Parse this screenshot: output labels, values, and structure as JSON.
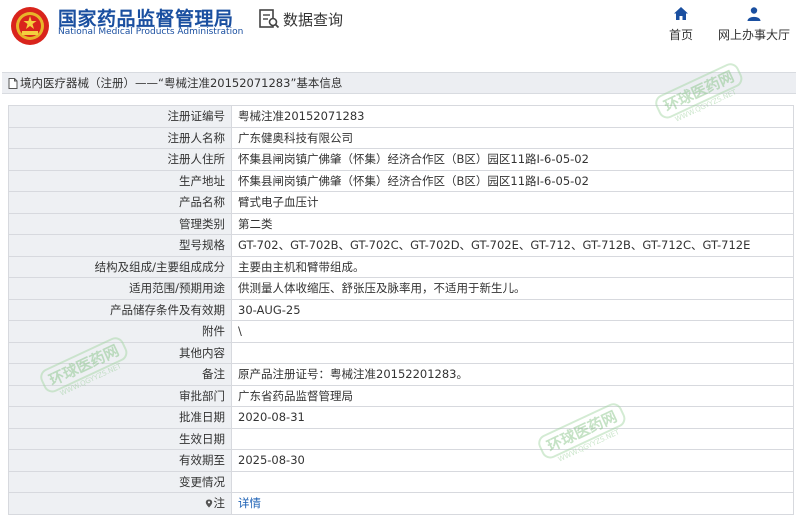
{
  "header": {
    "org_name_cn": "国家药品监督管理局",
    "org_name_en": "National Medical Products Administration",
    "query_label": "数据查询",
    "nav": {
      "home": "首页",
      "online_hall": "网上办事大厅"
    }
  },
  "breadcrumb": "境内医疗器械（注册）——“粤械注准20152071283”基本信息",
  "watermark": {
    "brand": "环球医药网",
    "site": "WWW.QGYYZS.NET"
  },
  "record": {
    "reg_no": {
      "label": "注册证编号",
      "value": "粤械注准20152071283"
    },
    "registrant": {
      "label": "注册人名称",
      "value": "广东健奥科技有限公司"
    },
    "residence": {
      "label": "注册人住所",
      "value": "怀集县闸岗镇广佛肇（怀集）经济合作区（B区）园区11路Ⅰ-6-05-02"
    },
    "mfg_address": {
      "label": "生产地址",
      "value": "怀集县闸岗镇广佛肇（怀集）经济合作区（B区）园区11路Ⅰ-6-05-02"
    },
    "product_name": {
      "label": "产品名称",
      "value": "臂式电子血压计"
    },
    "category": {
      "label": "管理类别",
      "value": "第二类"
    },
    "models": {
      "label": "型号规格",
      "value": "GT-702、GT-702B、GT-702C、GT-702D、GT-702E、GT-712、GT-712B、GT-712C、GT-712E"
    },
    "structure": {
      "label": "结构及组成/主要组成成分",
      "value": "主要由主机和臂带组成。"
    },
    "scope": {
      "label": "适用范围/预期用途",
      "value": "供测量人体收缩压、舒张压及脉率用，不适用于新生儿。"
    },
    "storage": {
      "label": "产品储存条件及有效期",
      "value": "30-AUG-25"
    },
    "attachment": {
      "label": "附件",
      "value": "\\"
    },
    "other": {
      "label": "其他内容",
      "value": ""
    },
    "remarks": {
      "label": "备注",
      "value": "原产品注册证号：粤械注准20152201283。"
    },
    "dept": {
      "label": "审批部门",
      "value": "广东省药品监督管理局"
    },
    "approval_date": {
      "label": "批准日期",
      "value": "2020-08-31"
    },
    "effective_date": {
      "label": "生效日期",
      "value": ""
    },
    "expiry": {
      "label": "有效期至",
      "value": "2025-08-30"
    },
    "changes": {
      "label": "变更情况",
      "value": ""
    },
    "note": {
      "label": "注",
      "value": "详情"
    }
  }
}
